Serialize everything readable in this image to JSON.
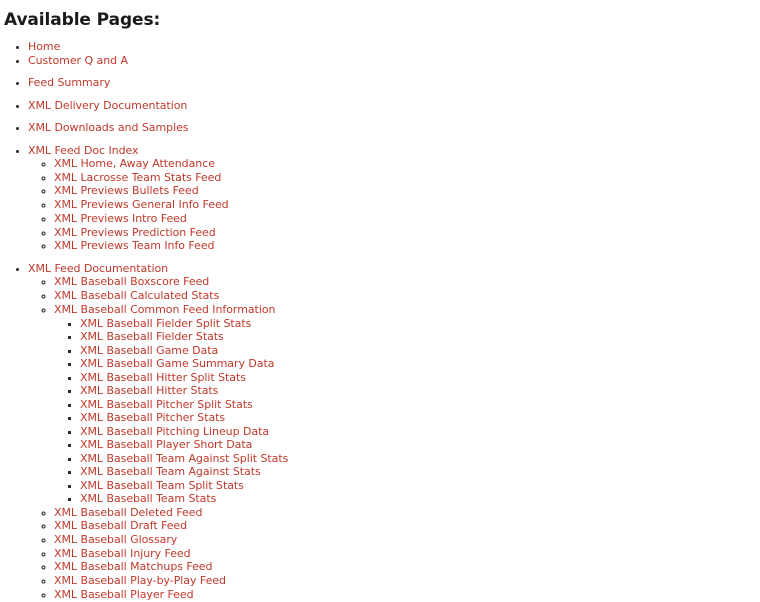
{
  "page": {
    "title": "Available Pages:",
    "link_color": "#c0392b",
    "title_color": "#1a1a1a",
    "background_color": "#ffffff",
    "marker_color": "#2b2b2b"
  },
  "groups": [
    {
      "name": "primary-links",
      "items": [
        {
          "label": "Home"
        },
        {
          "label": "Customer Q and A"
        }
      ]
    },
    {
      "name": "feed-summary",
      "items": [
        {
          "label": "Feed Summary"
        }
      ]
    },
    {
      "name": "xml-delivery-documentation",
      "items": [
        {
          "label": "XML Delivery Documentation"
        }
      ]
    },
    {
      "name": "xml-downloads-and-samples",
      "items": [
        {
          "label": "XML Downloads and Samples"
        }
      ]
    },
    {
      "name": "xml-feed-doc-index",
      "items": [
        {
          "label": "XML Feed Doc Index",
          "children": [
            {
              "label": "XML Home, Away Attendance"
            },
            {
              "label": "XML Lacrosse Team Stats Feed"
            },
            {
              "label": "XML Previews Bullets Feed"
            },
            {
              "label": "XML Previews General Info Feed"
            },
            {
              "label": "XML Previews Intro Feed"
            },
            {
              "label": "XML Previews Prediction Feed"
            },
            {
              "label": "XML Previews Team Info Feed"
            }
          ]
        }
      ]
    },
    {
      "name": "xml-feed-documentation",
      "items": [
        {
          "label": "XML Feed Documentation",
          "children": [
            {
              "label": "XML Baseball Boxscore Feed"
            },
            {
              "label": "XML Baseball Calculated Stats"
            },
            {
              "label": "XML Baseball Common Feed Information",
              "children": [
                {
                  "label": "XML Baseball Fielder Split Stats"
                },
                {
                  "label": "XML Baseball Fielder Stats"
                },
                {
                  "label": "XML Baseball Game Data"
                },
                {
                  "label": "XML Baseball Game Summary Data"
                },
                {
                  "label": "XML Baseball Hitter Split Stats"
                },
                {
                  "label": "XML Baseball Hitter Stats"
                },
                {
                  "label": "XML Baseball Pitcher Split Stats"
                },
                {
                  "label": "XML Baseball Pitcher Stats"
                },
                {
                  "label": "XML Baseball Pitching Lineup Data"
                },
                {
                  "label": "XML Baseball Player Short Data"
                },
                {
                  "label": "XML Baseball Team Against Split Stats"
                },
                {
                  "label": "XML Baseball Team Against Stats"
                },
                {
                  "label": "XML Baseball Team Split Stats"
                },
                {
                  "label": "XML Baseball Team Stats"
                }
              ]
            },
            {
              "label": "XML Baseball Deleted Feed"
            },
            {
              "label": "XML Baseball Draft Feed"
            },
            {
              "label": "XML Baseball Glossary"
            },
            {
              "label": "XML Baseball Injury Feed"
            },
            {
              "label": "XML Baseball Matchups Feed"
            },
            {
              "label": "XML Baseball Play-by-Play Feed"
            },
            {
              "label": "XML Baseball Player Feed"
            }
          ]
        }
      ]
    }
  ]
}
